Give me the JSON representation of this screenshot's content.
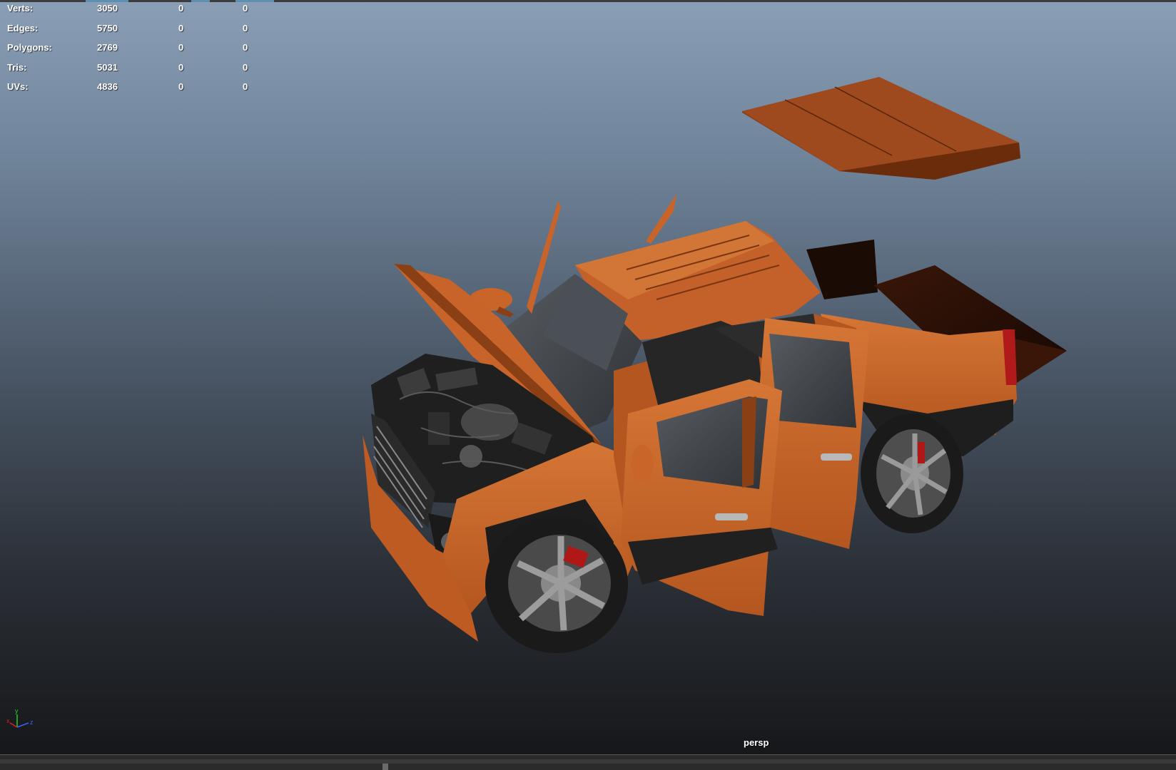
{
  "hud": {
    "stats": [
      {
        "label": "Verts:",
        "c1": "3050",
        "c2": "0",
        "c3": "0"
      },
      {
        "label": "Edges:",
        "c1": "5750",
        "c2": "0",
        "c3": "0"
      },
      {
        "label": "Polygons:",
        "c1": "2769",
        "c2": "0",
        "c3": "0"
      },
      {
        "label": "Tris:",
        "c1": "5031",
        "c2": "0",
        "c3": "0"
      },
      {
        "label": "UVs:",
        "c1": "4836",
        "c2": "0",
        "c3": "0"
      }
    ]
  },
  "viewport": {
    "camera": "persp"
  },
  "axis_gizmo": {
    "x": "x",
    "y": "y",
    "z": "z",
    "colors": {
      "x": "#e02020",
      "y": "#20d020",
      "z": "#4060ff"
    }
  },
  "colors": {
    "body": "#c8642a",
    "body_shadow": "#8a3f15",
    "body_highlight": "#d97a3c",
    "glass": "#3e4247",
    "tire": "#1c1c1c",
    "rim": "#7a7a7a",
    "brake": "#c01818",
    "engine": "#2a2a2a"
  },
  "icons": [
    "axis-gizmo-icon"
  ]
}
